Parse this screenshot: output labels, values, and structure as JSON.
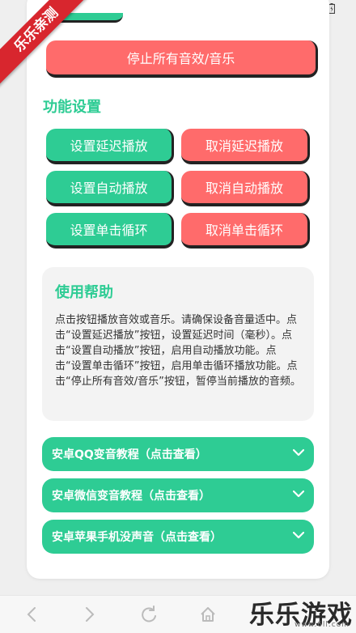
{
  "ribbon": {
    "label": "乐乐亲测"
  },
  "actions": {
    "stop_all_label": "停止所有音效/音乐"
  },
  "settings": {
    "title": "功能设置",
    "set_delay_label": "设置延迟播放",
    "cancel_delay_label": "取消延迟播放",
    "set_auto_label": "设置自动播放",
    "cancel_auto_label": "取消自动播放",
    "set_loop_label": "设置单击循环",
    "cancel_loop_label": "取消单击循环"
  },
  "help": {
    "title": "使用帮助",
    "body": "点击按钮播放音效或音乐。请确保设备音量适中。点击“设置延迟播放”按钮，设置延迟时间（毫秒）。点击“设置自动播放”按钮，启用自动播放功能。点击“设置单击循环”按钮，启用单击循环播放功能。点击“停止所有音效/音乐”按钮，暂停当前播放的音频。"
  },
  "tutorials": [
    {
      "label": "安卓QQ变音教程（点击查看）"
    },
    {
      "label": "安卓微信变音教程（点击查看）"
    },
    {
      "label": "安卓苹果手机没声音（点击查看）"
    }
  ],
  "watermark": {
    "brand": "乐乐游戏",
    "url": "www.6ll.com"
  },
  "colors": {
    "green": "#2ecc94",
    "red": "#ff6b6b",
    "ribbon": "#d8262e"
  },
  "icons": [
    "wifi-icon",
    "signal-icon",
    "battery-icon",
    "back-arrow-icon",
    "forward-arrow-icon",
    "refresh-icon",
    "home-icon",
    "chevron-down-icon"
  ]
}
